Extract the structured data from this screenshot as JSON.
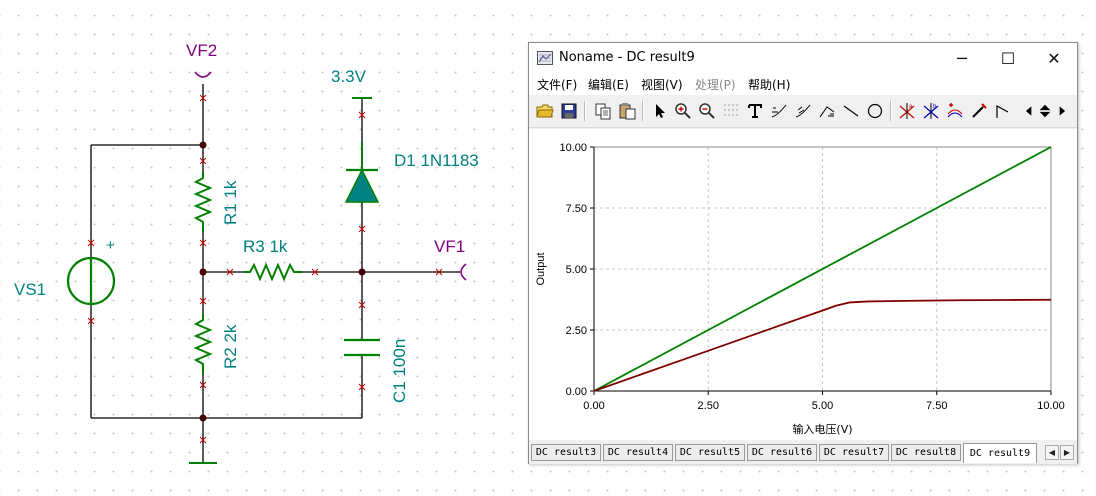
{
  "schematic": {
    "vf2_label": "VF2",
    "vf1_label": "VF1",
    "supply_label": "3.3V",
    "vs1_label": "VS1",
    "vs1_plus": "+",
    "r1_label": "R1 1k",
    "r2_label": "R2 2k",
    "r3_label": "R3 1k",
    "c1_label": "C1 100n",
    "d1_label": "D1 1N1183",
    "colors": {
      "wire": "#000000",
      "component": "#008000",
      "label": "#008080",
      "probe": "#800080",
      "pin": "#cc0000"
    }
  },
  "window": {
    "title": "Noname - DC result9",
    "menus": [
      {
        "label": "文件(F)",
        "enabled": true
      },
      {
        "label": "编辑(E)",
        "enabled": true
      },
      {
        "label": "视图(V)",
        "enabled": true
      },
      {
        "label": "处理(P)",
        "enabled": false
      },
      {
        "label": "帮助(H)",
        "enabled": true
      }
    ],
    "toolbar_icons": [
      "open-icon",
      "save-icon",
      "copy-icon",
      "paste-icon",
      "pointer-icon",
      "zoom-in-icon",
      "zoom-out-icon",
      "grid-icon",
      "text-icon",
      "curve-label-icon",
      "curve-label2-icon",
      "axis-label-icon",
      "line-icon",
      "ellipse-icon",
      "cursor-a-icon",
      "cursor-b-icon",
      "add-curve-icon",
      "marker-icon",
      "step-icon",
      "scroll-left-icon",
      "scroll-updown-icon",
      "scroll-right-icon"
    ],
    "tabs": [
      "DC result3",
      "DC result4",
      "DC result5",
      "DC result6",
      "DC result7",
      "DC result8",
      "DC result9"
    ],
    "active_tab": "DC result9"
  },
  "chart_data": {
    "type": "line",
    "title": "",
    "xlabel": "输入电压(V)",
    "ylabel": "Output",
    "xlim": [
      0,
      10
    ],
    "ylim": [
      0,
      10
    ],
    "x_ticks": [
      "0.00",
      "2.50",
      "5.00",
      "7.50",
      "10.00"
    ],
    "y_ticks": [
      "0.00",
      "2.50",
      "5.00",
      "7.50",
      "10.00"
    ],
    "grid": true,
    "series": [
      {
        "color": "#008000",
        "x": [
          0,
          10
        ],
        "y": [
          0,
          10
        ]
      },
      {
        "color": "#800000",
        "x": [
          0,
          1,
          2,
          3,
          4,
          5,
          5.3,
          5.6,
          6,
          7,
          8,
          9,
          10
        ],
        "y": [
          0,
          0.66,
          1.32,
          1.98,
          2.64,
          3.3,
          3.5,
          3.63,
          3.67,
          3.7,
          3.72,
          3.73,
          3.74
        ]
      }
    ]
  }
}
